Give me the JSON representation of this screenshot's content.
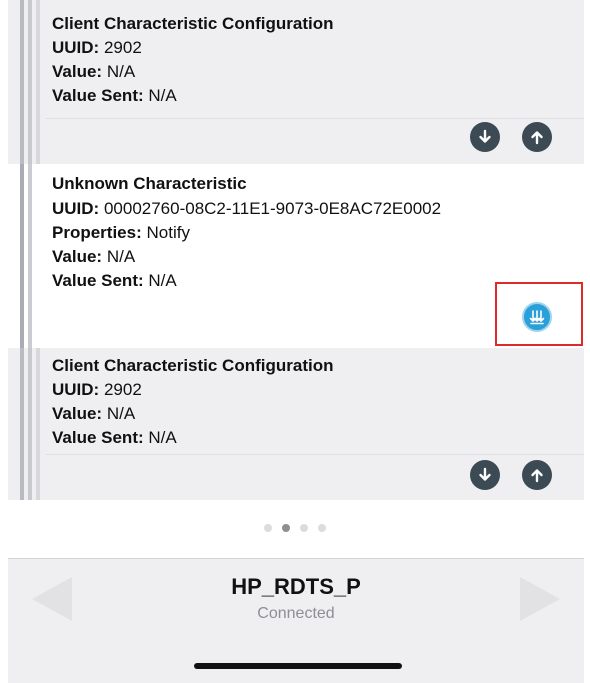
{
  "descriptors": [
    {
      "title": "Client Characteristic Configuration",
      "uuid_label": "UUID:",
      "uuid": "2902",
      "value_label": "Value:",
      "value": "N/A",
      "sent_label": "Value Sent:",
      "sent": "N/A",
      "buttons": [
        "read-icon",
        "write-icon"
      ]
    },
    {
      "title": "Unknown Characteristic",
      "uuid_label": "UUID:",
      "uuid": "00002760-08C2-11E1-9073-0E8AC72E0002",
      "properties_label": "Properties:",
      "properties": "Notify",
      "value_label": "Value:",
      "value": "N/A",
      "sent_label": "Value Sent:",
      "sent": "N/A",
      "buttons": [
        "notify-icon"
      ]
    },
    {
      "title": "Client Characteristic Configuration",
      "uuid_label": "UUID:",
      "uuid": "2902",
      "value_label": "Value:",
      "value": "N/A",
      "sent_label": "Value Sent:",
      "sent": "N/A",
      "buttons": [
        "read-icon",
        "write-icon"
      ]
    }
  ],
  "pager": {
    "count": 4,
    "active": 1
  },
  "footer": {
    "device_name": "HP_RDTS_P",
    "status": "Connected"
  },
  "colors": {
    "highlight": "#e02a2a",
    "notify": "#2a9fd8",
    "button": "#3b4a54"
  }
}
